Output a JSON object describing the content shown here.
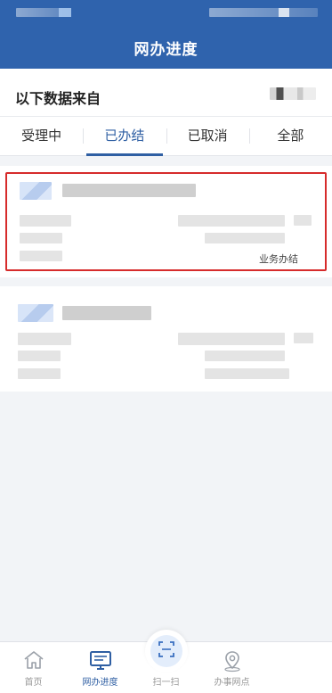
{
  "header": {
    "title": "网办进度"
  },
  "source": {
    "label": "以下数据来自"
  },
  "tabs": [
    {
      "label": "受理中",
      "active": false
    },
    {
      "label": "已办结",
      "active": true
    },
    {
      "label": "已取消",
      "active": false
    },
    {
      "label": "全部",
      "active": false
    }
  ],
  "records": [
    {
      "status": "业务办结",
      "highlighted": true
    },
    {
      "status": "",
      "highlighted": false
    }
  ],
  "bottom_nav": [
    {
      "label": "首页",
      "icon": "home-icon"
    },
    {
      "label": "网办进度",
      "icon": "monitor-icon",
      "active": true
    },
    {
      "label": "扫一扫",
      "icon": "scan-icon"
    },
    {
      "label": "办事网点",
      "icon": "location-pin-icon"
    }
  ],
  "colors": {
    "primary": "#2f63ad",
    "highlight_border": "#d62b2b",
    "background": "#f2f4f7"
  }
}
